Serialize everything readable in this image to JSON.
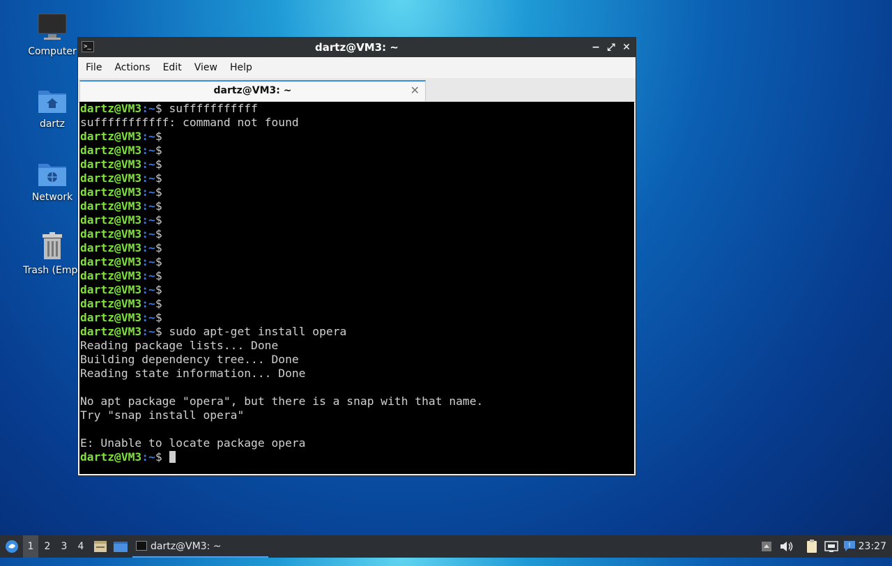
{
  "desktop": {
    "icons": [
      {
        "label": "Computer"
      },
      {
        "label": "dartz"
      },
      {
        "label": "Network"
      },
      {
        "label": "Trash (Empt"
      }
    ]
  },
  "window": {
    "title": "dartz@VM3: ~",
    "controls": {
      "minimize": "−",
      "maximize": "⤢",
      "close": "✕"
    },
    "menu": [
      "File",
      "Actions",
      "Edit",
      "View",
      "Help"
    ],
    "tab": {
      "title": "dartz@VM3: ~",
      "close": "✕"
    }
  },
  "terminal": {
    "prompt_user": "dartz@VM3",
    "prompt_path": ":~",
    "prompt_symbol": "$",
    "lines": [
      "dartz@VM3:~$ sufffffffffff",
      "sufffffffffff: command not found",
      "dartz@VM3:~$",
      "dartz@VM3:~$",
      "dartz@VM3:~$",
      "dartz@VM3:~$",
      "dartz@VM3:~$",
      "dartz@VM3:~$",
      "dartz@VM3:~$",
      "dartz@VM3:~$",
      "dartz@VM3:~$",
      "dartz@VM3:~$",
      "dartz@VM3:~$",
      "dartz@VM3:~$",
      "dartz@VM3:~$",
      "dartz@VM3:~$",
      "dartz@VM3:~$ sudo apt-get install opera",
      "Reading package lists... Done",
      "Building dependency tree... Done",
      "Reading state information... Done",
      "",
      "No apt package \"opera\", but there is a snap with that name.",
      "Try \"snap install opera\"",
      "",
      "E: Unable to locate package opera",
      "dartz@VM3:~$ "
    ]
  },
  "taskbar": {
    "workspaces": [
      "1",
      "2",
      "3",
      "4"
    ],
    "active_workspace": "1",
    "task_title": "dartz@VM3: ~",
    "clock": "23:27"
  },
  "colors": {
    "prompt_user": "#7ee23a",
    "prompt_path": "#3b7be0",
    "terminal_bg": "#000000",
    "titlebar_bg": "#2f3336",
    "taskbar_bg": "#2c2f33",
    "tab_accent": "#3b8ee6"
  }
}
